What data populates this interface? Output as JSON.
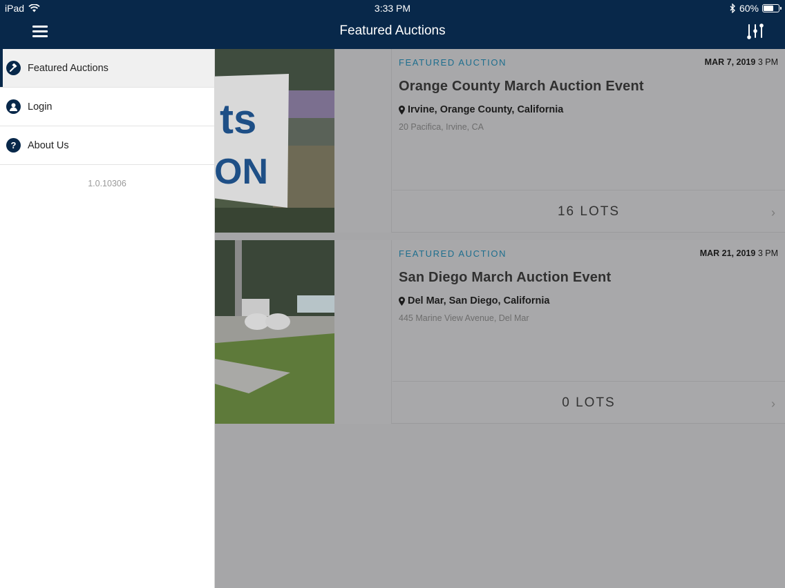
{
  "status_bar": {
    "device": "iPad",
    "time": "3:33 PM",
    "battery_pct": "60%"
  },
  "nav": {
    "title": "Featured Auctions"
  },
  "drawer": {
    "items": [
      {
        "label": "Featured Auctions",
        "icon": "gavel-icon",
        "active": true
      },
      {
        "label": "Login",
        "icon": "user-icon",
        "active": false
      },
      {
        "label": "About Us",
        "icon": "question-icon",
        "active": false
      }
    ],
    "version": "1.0.10306"
  },
  "auctions": [
    {
      "label": "FEATURED AUCTION",
      "date_bold": "MAR 7, 2019",
      "time": "3 PM",
      "title": "Orange County March Auction Event",
      "location": "Irvine, Orange County, California",
      "address": "20 Pacifica, Irvine, CA",
      "lots": "16 LOTS"
    },
    {
      "label": "FEATURED AUCTION",
      "date_bold": "MAR 21, 2019",
      "time": "3 PM",
      "title": "San Diego March Auction Event",
      "location": "Del Mar, San Diego, California",
      "address": "445 Marine View Avenue, Del Mar",
      "lots": "0 LOTS"
    }
  ],
  "image_text": {
    "sign_line1": "ts",
    "sign_line2": "ON"
  },
  "colors": {
    "nav_bg": "#08284a",
    "accent_label": "#1d6e8e"
  }
}
